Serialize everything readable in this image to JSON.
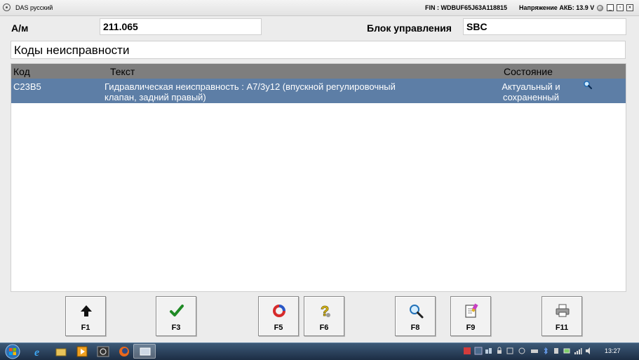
{
  "window": {
    "title": "DAS русский",
    "fin": "FIN : WDBUF65J63A118815",
    "battery": "Напряжение АКБ: 13.9 V",
    "controls": {
      "minimize": "_",
      "restore": "▫",
      "close": "×"
    }
  },
  "header": {
    "vehicle_label": "А/м",
    "vehicle_value": "211.065",
    "ecu_label": "Блок управления",
    "ecu_value": "SBC"
  },
  "section_title": "Коды неисправности",
  "table": {
    "columns": [
      "Код",
      "Текст",
      "Состояние"
    ],
    "rows": [
      {
        "code": "C23B5",
        "text": "Гидравлическая неисправность : A7/3y12 (впускной регулировочный клапан, задний правый)",
        "state": "Актуальный и сохраненный"
      }
    ]
  },
  "function_keys": [
    {
      "label": "F1",
      "icon": "arrow-up-icon"
    },
    {
      "label": "F3",
      "icon": "checkmark-icon"
    },
    {
      "label": "F5",
      "icon": "refresh-icon"
    },
    {
      "label": "F6",
      "icon": "help-icon"
    },
    {
      "label": "F8",
      "icon": "magnifier-icon"
    },
    {
      "label": "F9",
      "icon": "notepad-icon"
    },
    {
      "label": "F11",
      "icon": "printer-icon"
    }
  ],
  "taskbar": {
    "clock": "13:27"
  },
  "colors": {
    "header_bg": "#7e7e7e",
    "selected_row": "#5d7ea6",
    "taskbar": "#1c2d44"
  }
}
